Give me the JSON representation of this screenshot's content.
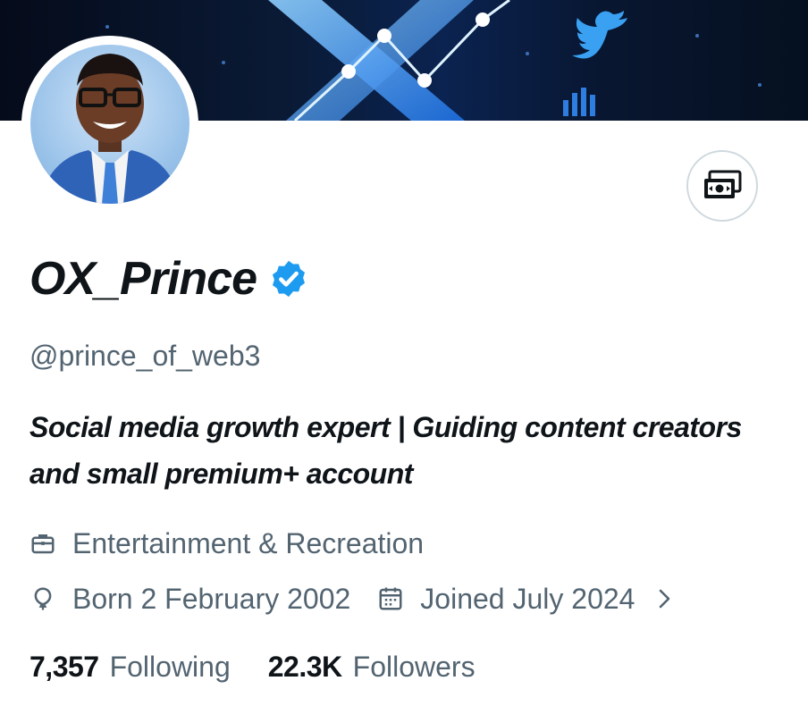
{
  "profile": {
    "display_name": "OX_Prince",
    "handle": "@prince_of_web3",
    "bio": "Social media growth expert | Guiding content creators and small premium+ account",
    "category": "Entertainment & Recreation",
    "born": "Born 2 February 2002",
    "joined": "Joined July 2024"
  },
  "stats": {
    "following_count": "7,357",
    "following_label": "Following",
    "followers_count": "22.3K",
    "followers_label": "Followers"
  },
  "colors": {
    "verified_badge": "#1d9bf0",
    "secondary_text": "#536471",
    "primary_text": "#0f1419"
  },
  "icons": {
    "verified": "verified-badge-icon",
    "money": "money-icon",
    "category": "briefcase-icon",
    "born": "balloon-icon",
    "joined": "calendar-icon",
    "expand": "chevron-right-icon"
  }
}
